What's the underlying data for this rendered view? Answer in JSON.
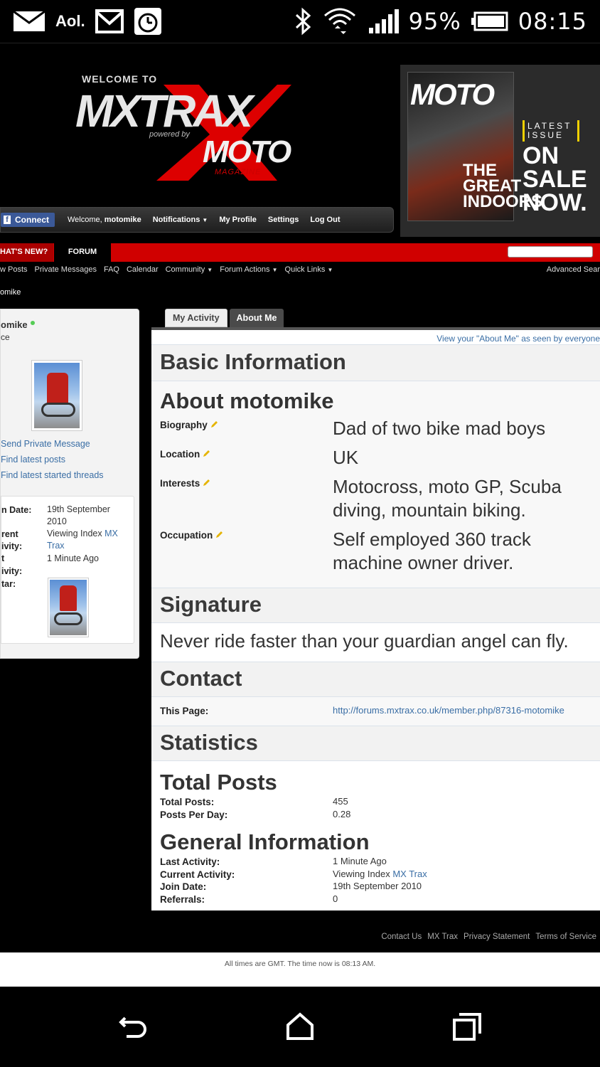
{
  "status_bar": {
    "aol": "Aol.",
    "battery": "95%",
    "time": "08:15"
  },
  "header": {
    "welcome_to": "WELCOME TO",
    "logo_mx": "MXTRAX",
    "powered_by": "powered by",
    "logo_moto": "MOTO",
    "logo_magazine": "MAGAZINE",
    "ad": {
      "cover_title": "MOTO",
      "cover_headline": "THE GREAT INDOORS",
      "latest_issue": "LATEST ISSUE",
      "sale": "ON SALE NOW."
    }
  },
  "navbar": {
    "connect": "Connect",
    "welcome": "Welcome,",
    "username": "motomike",
    "notifications": "Notifications",
    "my_profile": "My Profile",
    "settings": "Settings",
    "log_out": "Log Out"
  },
  "tabs": {
    "whats_new": "HAT'S NEW?",
    "forum": "FORUM"
  },
  "subnav": {
    "items": [
      "w Posts",
      "Private Messages",
      "FAQ",
      "Calendar",
      "Community",
      "Forum Actions",
      "Quick Links"
    ],
    "advanced_search": "Advanced Sear"
  },
  "breadcrumb": "omike",
  "sidebar": {
    "username": "omike",
    "rank": "ce",
    "links": [
      "Send Private Message",
      "Find latest posts",
      "Find latest started threads"
    ],
    "join_label": "n Date:",
    "join_value": "19th September 2010",
    "current_label": "rent",
    "current_label2": "ivity:",
    "current_value_pre": "Viewing Index ",
    "current_value_link": "MX Trax",
    "last_label": "t",
    "last_label2": "ivity:",
    "last_value": "1 Minute Ago",
    "avatar_label": "tar:"
  },
  "content_tabs": {
    "my_activity": "My Activity",
    "about_me": "About Me"
  },
  "panel": {
    "view_about": "View your \"About Me\" as seen by everyone",
    "basic_info": "Basic Information",
    "about_title": "About motomike",
    "biography_label": "Biography",
    "biography_value": "Dad of two bike mad boys",
    "location_label": "Location",
    "location_value": "UK",
    "interests_label": "Interests",
    "interests_value": "Motocross, moto GP, Scuba diving, mountain biking.",
    "occupation_label": "Occupation",
    "occupation_value": "Self employed 360 track machine owner driver.",
    "signature_title": "Signature",
    "signature_value": "Never ride faster than your guardian angel can fly.",
    "contact_title": "Contact",
    "this_page_label": "This Page:",
    "this_page_value": "http://forums.mxtrax.co.uk/member.php/87316-motomike",
    "statistics_title": "Statistics",
    "total_posts_title": "Total Posts",
    "total_posts_label": "Total Posts:",
    "total_posts_value": "455",
    "ppd_label": "Posts Per Day:",
    "ppd_value": "0.28",
    "general_title": "General Information",
    "last_activity_label": "Last Activity:",
    "last_activity_value": "1 Minute Ago",
    "current_activity_label": "Current Activity:",
    "current_activity_pre": "Viewing Index ",
    "current_activity_link": "MX Trax",
    "join_date_label": "Join Date:",
    "join_date_value": "19th September 2010",
    "referrals_label": "Referrals:",
    "referrals_value": "0"
  },
  "footer": {
    "links": [
      "Contact Us",
      "MX Trax",
      "Privacy Statement",
      "Terms of Service"
    ],
    "time_note": "All times are GMT. The time now is 08:13 AM."
  }
}
